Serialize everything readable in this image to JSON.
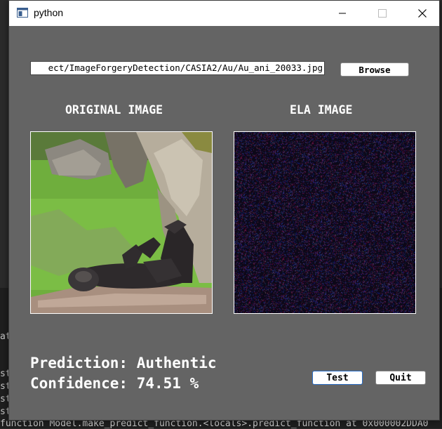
{
  "terminal": {
    "lines": [
      "at",
      "st",
      "st",
      "st",
      "st"
    ],
    "bottom_line": "function Model.make_predict_function.<locals>.predict_function at 0x000002DDA0"
  },
  "window": {
    "title": "python",
    "app_icon": "window-app-icon",
    "controls": [
      "minimize-icon",
      "maximize-icon",
      "close-icon"
    ]
  },
  "file": {
    "path": "ect/ImageForgeryDetection/CASIA2/Au/Au_ani_20033.jpg",
    "browse_label": "Browse"
  },
  "panels": {
    "original_title": "ORIGINAL IMAGE",
    "ela_title": "ELA IMAGE"
  },
  "result": {
    "prediction_line": "Prediction: Authentic",
    "confidence_line": "Confidence: 74.51 %"
  },
  "buttons": {
    "test_label": "Test",
    "quit_label": "Quit"
  },
  "colors": {
    "window_bg": "#646464",
    "ela_bg": "#0c0818",
    "focus_border": "#2a6fc9"
  }
}
